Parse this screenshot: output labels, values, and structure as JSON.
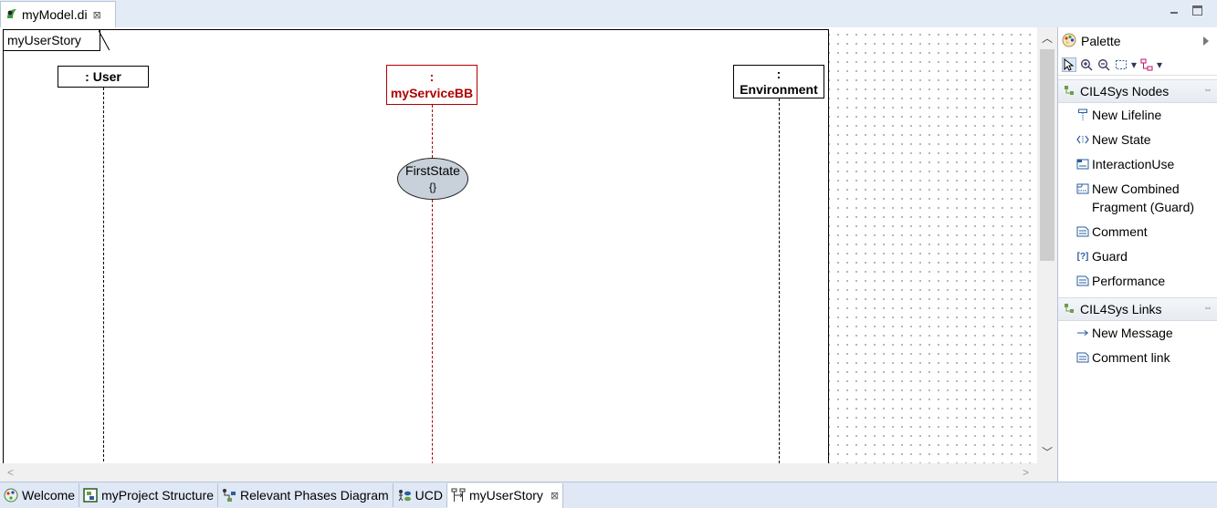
{
  "editor": {
    "tab_title": "myModel.di",
    "close_glyph": "⊠"
  },
  "diagram": {
    "frame_title": "myUserStory",
    "lifelines": [
      {
        "name": ": User",
        "color": "#000000"
      },
      {
        "name_line1": ":",
        "name_line2": "myServiceBB",
        "color": "#b00000"
      },
      {
        "name_line1": ":",
        "name_line2": "Environment",
        "color": "#000000"
      }
    ],
    "state": {
      "name": "FirstState",
      "body": "{}"
    }
  },
  "palette": {
    "title": "Palette",
    "toolbar_icons": [
      "select-arrow-icon",
      "zoom-in-icon",
      "zoom-out-icon",
      "marquee-icon",
      "dropdown-icon",
      "connection-icon",
      "dropdown-icon"
    ],
    "drawers": [
      {
        "label": "CIL4Sys Nodes",
        "items": [
          {
            "label": "New Lifeline",
            "icon": "lifeline-icon"
          },
          {
            "label": "New State",
            "icon": "state-icon"
          },
          {
            "label": "InteractionUse",
            "icon": "interaction-use-icon"
          },
          {
            "label": "New Combined Fragment (Guard)",
            "icon": "combined-fragment-icon"
          },
          {
            "label": "Comment",
            "icon": "comment-icon"
          },
          {
            "label": "Guard",
            "icon": "guard-icon"
          },
          {
            "label": "Performance",
            "icon": "performance-icon"
          }
        ]
      },
      {
        "label": "CIL4Sys Links",
        "items": [
          {
            "label": "New Message",
            "icon": "message-arrow-icon"
          },
          {
            "label": "Comment link",
            "icon": "comment-link-icon"
          }
        ]
      }
    ]
  },
  "bottom_tabs": [
    {
      "label": "Welcome",
      "icon": "welcome-icon",
      "active": false
    },
    {
      "label": "myProject Structure",
      "icon": "structure-icon",
      "active": false
    },
    {
      "label": "Relevant Phases Diagram",
      "icon": "phases-icon",
      "active": false
    },
    {
      "label": "UCD",
      "icon": "ucd-icon",
      "active": false
    },
    {
      "label": "myUserStory",
      "icon": "sequence-icon",
      "active": true
    }
  ],
  "colors": {
    "accent": "#2a5d9f",
    "selected_lifeline": "#b00000",
    "state_fill": "#c8d1da"
  }
}
